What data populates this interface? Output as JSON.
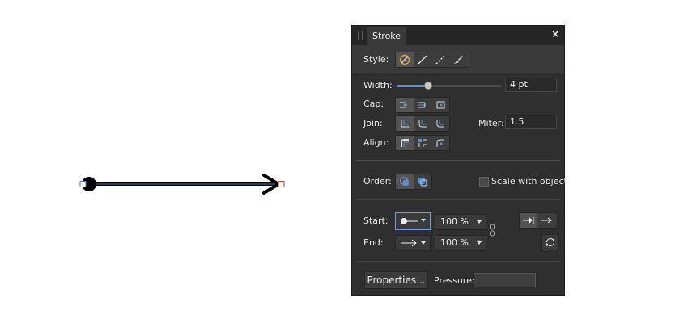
{
  "panel": {
    "title": "Stroke",
    "close_glyph": "×",
    "style_label": "Style:",
    "width_label": "Width:",
    "width_value": "4 pt",
    "width_slider_fraction": 0.3,
    "cap_label": "Cap:",
    "join_label": "Join:",
    "miter_label": "Miter:",
    "miter_value": "1.5",
    "align_label": "Align:",
    "order_label": "Order:",
    "scale_label": "Scale with object",
    "scale_checked": false,
    "start_label": "Start:",
    "start_scale": "100 %",
    "end_label": "End:",
    "end_scale": "100 %",
    "properties_label": "Properties...",
    "pressure_label": "Pressure:"
  },
  "icons": {
    "style": [
      "no-stroke-icon",
      "solid-line-icon",
      "dashed-line-icon",
      "brush-stroke-icon"
    ],
    "cap": [
      "butt-cap-icon",
      "round-cap-icon",
      "square-cap-icon"
    ],
    "join": [
      "miter-join-icon",
      "round-join-icon",
      "bevel-join-icon"
    ],
    "align": [
      "align-center-icon",
      "align-inside-icon",
      "align-outside-icon"
    ],
    "order": [
      "stroke-behind-fill-icon",
      "stroke-front-fill-icon"
    ],
    "arrowhead_position": [
      "arrowhead-beyond-icon",
      "arrowhead-at-end-icon"
    ],
    "link": "link-icon",
    "swap": "swap-icon"
  },
  "colors": {
    "panel_bg": "#2f2f2f",
    "accent": "#5b8fd4",
    "canvas_stroke": "#000000",
    "selection": "#4a7bd0"
  }
}
